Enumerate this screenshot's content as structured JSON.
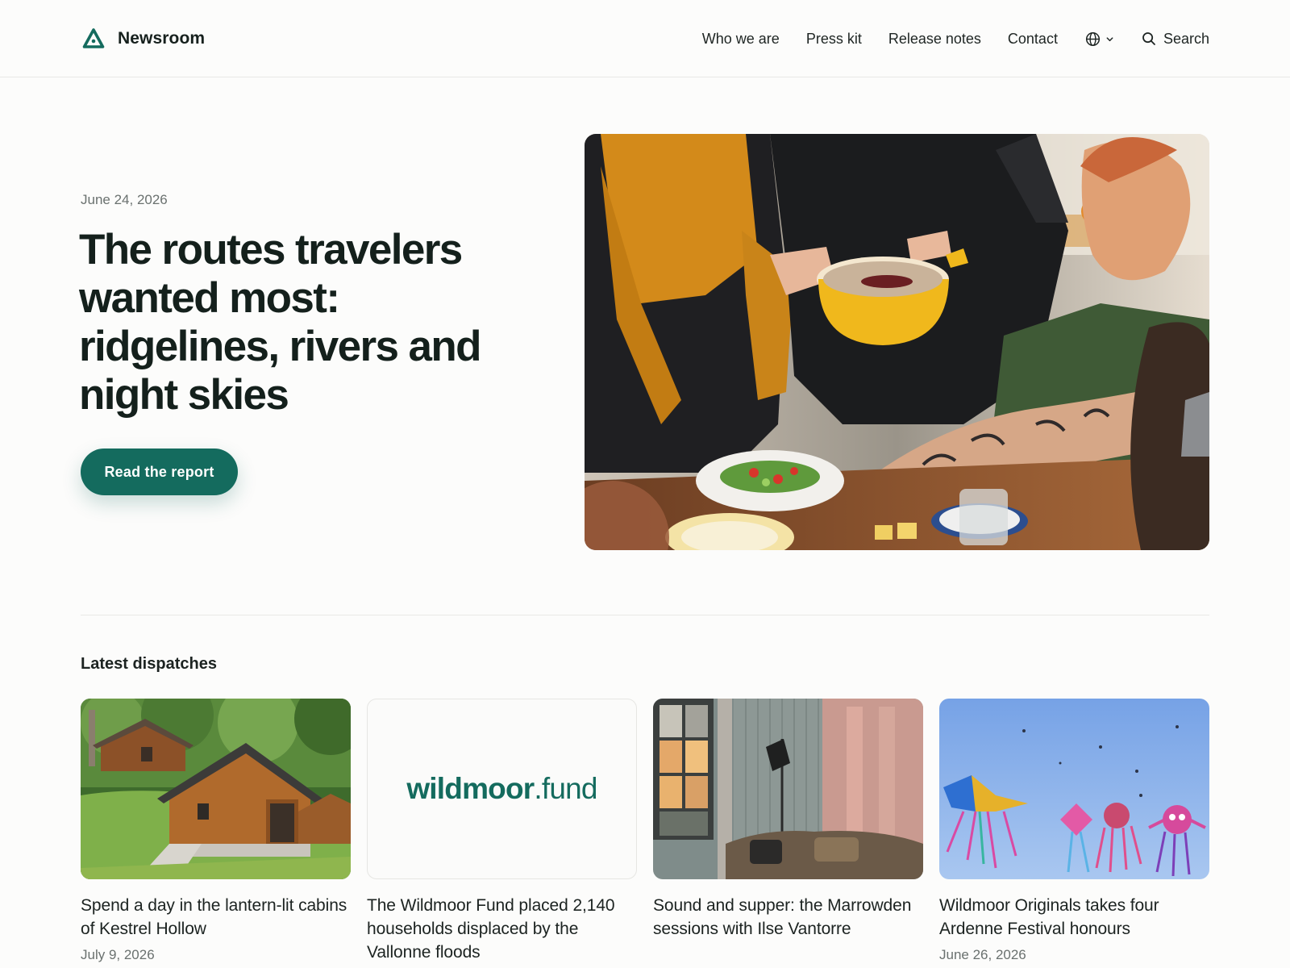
{
  "header": {
    "brand": "Newsroom",
    "nav": [
      "Who we are",
      "Press kit",
      "Release notes",
      "Contact"
    ],
    "search_label": "Search"
  },
  "hero": {
    "date": "June 24, 2026",
    "title": "The routes travelers wanted most: ridgelines, rivers and night skies",
    "cta_label": "Read the report"
  },
  "latest": {
    "title": "Latest dispatches",
    "cards": [
      {
        "title": "Spend a day in the lantern-lit cabins of Kestrel Hollow",
        "date": "July 9, 2026",
        "image": "cabin-photo"
      },
      {
        "title": "The Wildmoor Fund placed 2,140 households displaced by the Vallonne floods",
        "date": "",
        "image": "wildmoor-fund-logo",
        "wordmark": [
          "wildmoor",
          ".fund"
        ]
      },
      {
        "title": "Sound and supper: the Marrowden sessions with Ilse Vantorre",
        "date": "",
        "image": "living-room-photo"
      },
      {
        "title": "Wildmoor Originals takes four Ardenne Festival honours",
        "date": "June 26, 2026",
        "image": "kites-photo"
      }
    ]
  },
  "colors": {
    "accent": "#146b5e",
    "text": "#1c2321",
    "muted": "#6a716f",
    "background": "#fcfcfb"
  },
  "icons": [
    "newsroom-logo-icon",
    "globe-icon",
    "chevron-down-icon",
    "search-icon"
  ]
}
